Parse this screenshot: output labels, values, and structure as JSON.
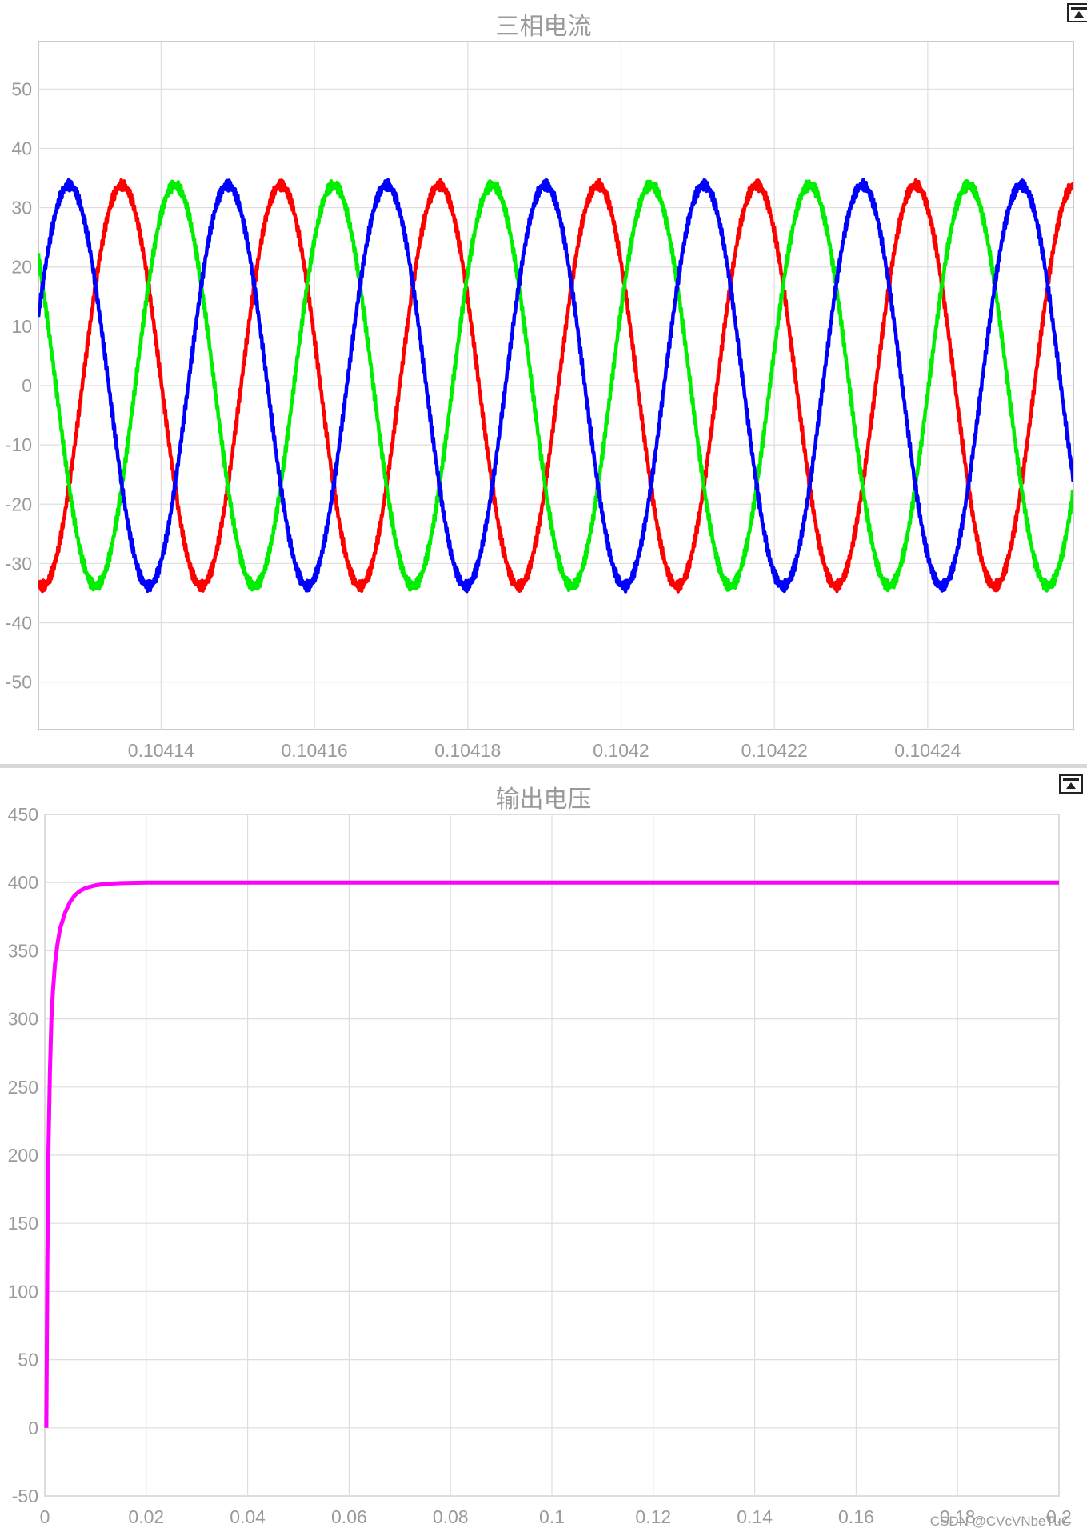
{
  "colors": {
    "phase_a": "#ff0000",
    "phase_b": "#00ee00",
    "phase_c": "#0000ff",
    "voltage": "#ff00ff",
    "grid": "#dedede",
    "axis": "#b8b8b8",
    "text": "#9a9a9a"
  },
  "icons": {
    "restore": "restore-view-icon"
  },
  "watermark": "CSDN @CVcVNbeTuC",
  "chart_data": [
    {
      "type": "line",
      "title": "三相电流",
      "xlabel": "",
      "ylabel": "",
      "xlim": [
        0.104124,
        0.104259
      ],
      "ylim": [
        -58,
        58
      ],
      "x_ticks": [
        0.10414,
        0.10416,
        0.10418,
        0.1042,
        0.10422,
        0.10424
      ],
      "x_tick_labels": [
        "0.10414",
        "0.10416",
        "0.10418",
        "0.1042",
        "0.10422",
        "0.10424"
      ],
      "y_ticks": [
        -50,
        -40,
        -30,
        -20,
        -10,
        0,
        10,
        20,
        30,
        40,
        50
      ],
      "y_tick_labels": [
        "-50",
        "-40",
        "-30",
        "-20",
        "-10",
        "0",
        "10",
        "20",
        "30",
        "40",
        "50"
      ],
      "grid": true,
      "legend": "none",
      "series_form": {
        "shape": "sinusoid",
        "amplitude": 33.8,
        "period": 2.07e-05,
        "reference_peak_x": 0.1041418,
        "reference_peak_series": "phase_b",
        "phase_order": [
          "phase_b",
          "phase_c",
          "phase_a"
        ],
        "phase_shift_degrees": 120,
        "ripple": 0.6
      },
      "series": [
        {
          "color_key": "phase_a",
          "peaks_x": [
            0.1041338,
            0.1041545,
            0.1041752,
            0.1041959,
            0.1042166,
            0.1042373
          ],
          "amplitude": 33.8
        },
        {
          "color_key": "phase_b",
          "peaks_x": [
            0.1041418,
            0.1041625,
            0.1041832,
            0.1042039,
            0.1042246
          ],
          "amplitude": 33.8
        },
        {
          "color_key": "phase_c",
          "peaks_x": [
            0.1041269,
            0.1041476,
            0.1041683,
            0.104189,
            0.1042097,
            0.1042304
          ],
          "amplitude": 33.8
        }
      ]
    },
    {
      "type": "line",
      "title": "输出电压",
      "xlabel": "",
      "ylabel": "",
      "xlim": [
        0,
        0.2
      ],
      "ylim": [
        -50,
        450
      ],
      "x_ticks": [
        0,
        0.02,
        0.04,
        0.06,
        0.08,
        0.1,
        0.12,
        0.14,
        0.16,
        0.18,
        0.2
      ],
      "x_tick_labels": [
        "0",
        "0.02",
        "0.04",
        "0.06",
        "0.08",
        "0.1",
        "0.12",
        "0.14",
        "0.16",
        "0.18",
        "0.2"
      ],
      "y_ticks": [
        -50,
        0,
        50,
        100,
        150,
        200,
        250,
        300,
        350,
        400,
        450
      ],
      "y_tick_labels": [
        "-50",
        "0",
        "50",
        "100",
        "150",
        "200",
        "250",
        "300",
        "350",
        "400",
        "450"
      ],
      "grid": true,
      "legend": "none",
      "series": [
        {
          "color_key": "voltage",
          "x": [
            0.0003,
            0.0005,
            0.0007,
            0.001,
            0.0013,
            0.0016,
            0.002,
            0.0025,
            0.003,
            0.004,
            0.005,
            0.006,
            0.007,
            0.008,
            0.01,
            0.012,
            0.015,
            0.02,
            0.05,
            0.1,
            0.15,
            0.2
          ],
          "y": [
            0,
            120,
            200,
            260,
            300,
            320,
            340,
            355,
            366,
            378,
            386,
            391,
            394,
            396,
            398,
            399,
            399.6,
            400,
            400,
            400,
            400,
            400
          ]
        }
      ]
    }
  ]
}
